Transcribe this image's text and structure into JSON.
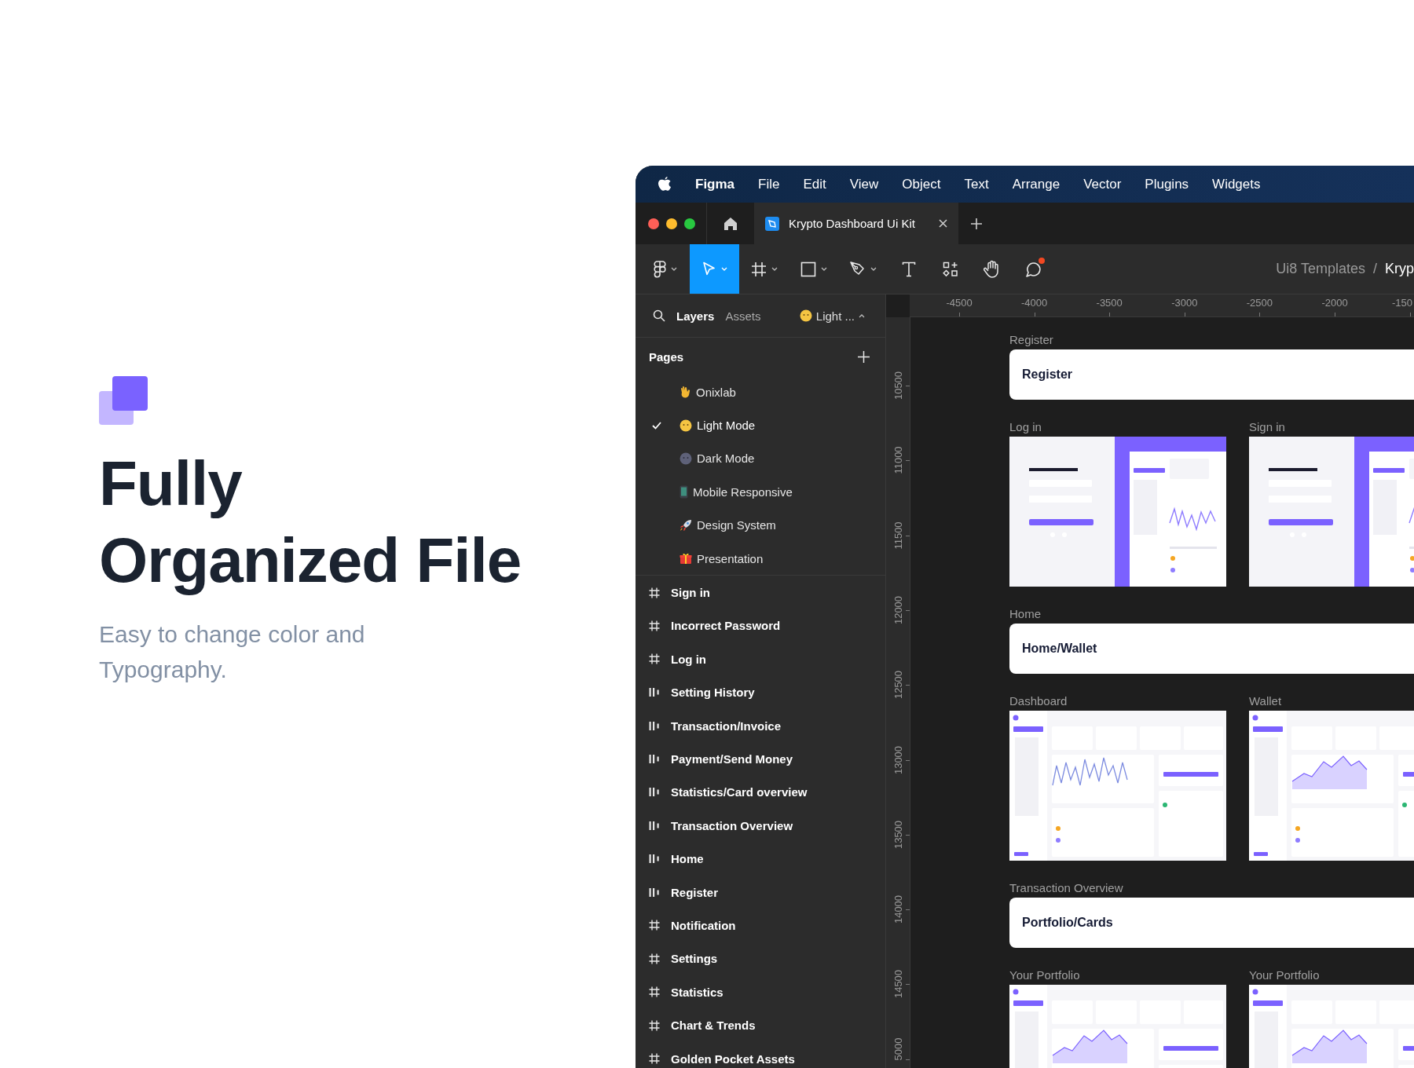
{
  "promo": {
    "heading_lines": [
      "Fully",
      "Organized File"
    ],
    "subtitle": "Easy to change color and Typography."
  },
  "menu_bar": {
    "app": "Figma",
    "items": [
      "File",
      "Edit",
      "View",
      "Object",
      "Text",
      "Arrange",
      "Vector",
      "Plugins",
      "Widgets"
    ]
  },
  "tabs": [
    {
      "title": "Krypto Dashboard Ui Kit",
      "selected": true
    }
  ],
  "toolbar": {
    "tools": [
      {
        "kind": "main-menu",
        "selected": false
      },
      {
        "kind": "move",
        "selected": true
      },
      {
        "kind": "frame",
        "selected": false
      },
      {
        "kind": "shape",
        "selected": false
      },
      {
        "kind": "pen",
        "selected": false
      },
      {
        "kind": "text",
        "selected": false
      },
      {
        "kind": "resources",
        "selected": false
      },
      {
        "kind": "hand",
        "selected": false
      },
      {
        "kind": "comment",
        "selected": false,
        "notification": true
      }
    ],
    "breadcrumb": {
      "items": [
        "Ui8 Templates",
        "Kryp"
      ],
      "separator": "/"
    }
  },
  "panel": {
    "tabs": [
      {
        "label": "Layers",
        "selected": true
      },
      {
        "label": "Assets",
        "selected": false
      }
    ],
    "page_switcher": "Light ...",
    "pages_title": "Pages",
    "pages": [
      {
        "name": "Onixlab",
        "selected": false
      },
      {
        "name": "Light Mode",
        "selected": true
      },
      {
        "name": "Dark Mode",
        "selected": false
      },
      {
        "name": "Mobile Responsive",
        "selected": false
      },
      {
        "name": "Design System",
        "selected": false
      },
      {
        "name": "Presentation",
        "selected": false
      }
    ],
    "layers": [
      {
        "name": "Sign in",
        "kind": "frame"
      },
      {
        "name": "Incorrect Password",
        "kind": "frame"
      },
      {
        "name": "Log in",
        "kind": "frame"
      },
      {
        "name": "Setting History",
        "kind": "autolayout"
      },
      {
        "name": "Transaction/Invoice",
        "kind": "autolayout"
      },
      {
        "name": "Payment/Send Money",
        "kind": "autolayout"
      },
      {
        "name": "Statistics/Card overview",
        "kind": "autolayout"
      },
      {
        "name": "Transaction Overview",
        "kind": "autolayout"
      },
      {
        "name": "Home",
        "kind": "autolayout"
      },
      {
        "name": "Register",
        "kind": "autolayout"
      },
      {
        "name": "Notification",
        "kind": "frame"
      },
      {
        "name": "Settings",
        "kind": "frame"
      },
      {
        "name": "Statistics",
        "kind": "frame"
      },
      {
        "name": "Chart & Trends",
        "kind": "frame"
      },
      {
        "name": "Golden Pocket Assets",
        "kind": "frame"
      }
    ]
  },
  "canvas": {
    "x_ruler": [
      "-4500",
      "-4000",
      "-3500",
      "-3000",
      "-2500",
      "-2000",
      "-150"
    ],
    "y_ruler": [
      "10500",
      "11000",
      "11500",
      "12000",
      "12500",
      "13000",
      "13500",
      "14000",
      "14500",
      "5000"
    ],
    "sections": [
      {
        "kind": "banner",
        "label": "Register",
        "title": "Register"
      },
      {
        "kind": "frames",
        "frames": [
          {
            "label": "Log in",
            "kind": "login"
          },
          {
            "label": "Sign in",
            "kind": "signup"
          }
        ]
      },
      {
        "kind": "banner",
        "label": "Home",
        "title": "Home/Wallet"
      },
      {
        "kind": "frames",
        "frames": [
          {
            "label": "Dashboard",
            "kind": "dashboard"
          },
          {
            "label": "Wallet",
            "kind": "wallet"
          }
        ]
      },
      {
        "kind": "banner",
        "label": "Transaction Overview",
        "title": "Portfolio/Cards"
      },
      {
        "kind": "frames",
        "frames": [
          {
            "label": "Your Portfolio",
            "kind": "portfolio"
          },
          {
            "label": "Your Portfolio",
            "kind": "portfolio"
          }
        ]
      }
    ]
  }
}
